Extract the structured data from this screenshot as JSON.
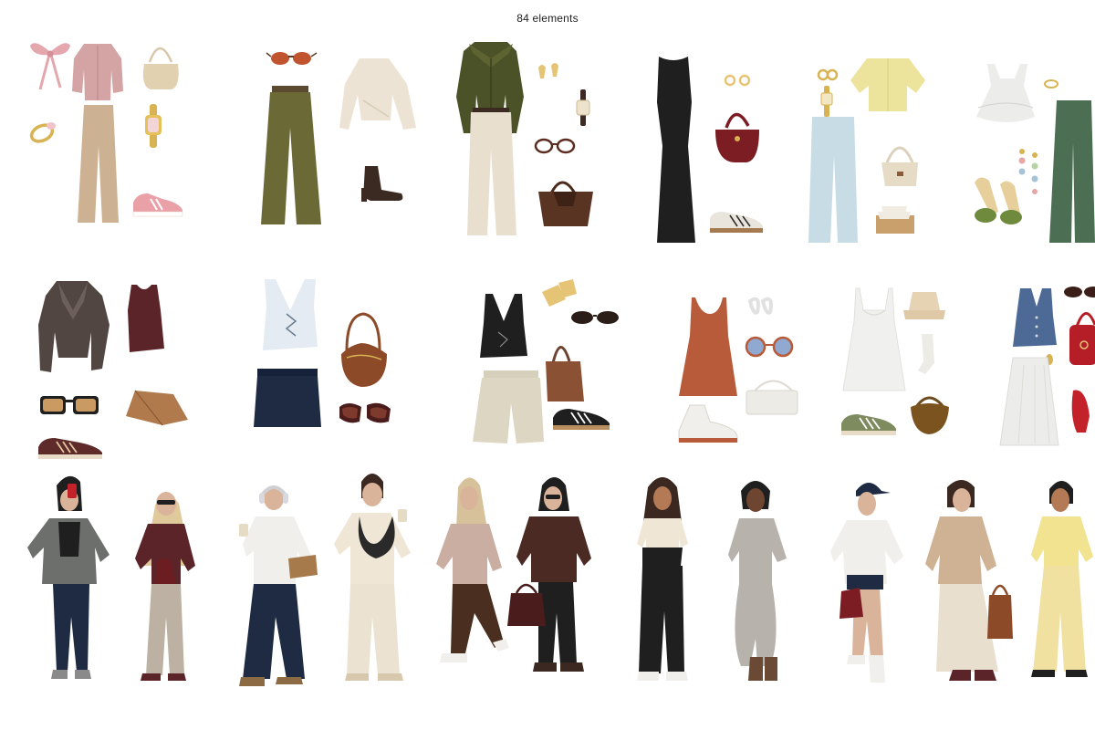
{
  "header": {
    "label": "84 elements"
  },
  "palette": {
    "background": "#ffffff",
    "pink": "#d9a5a8",
    "beige": "#cdb397",
    "olive": "#6c6a33",
    "forest": "#556237",
    "cream": "#e8dfcf",
    "black": "#1f1f1f",
    "burgundy": "#7b1d22",
    "light_blue": "#c8dce6",
    "butter_yellow": "#ece49c",
    "green": "#4c6e53",
    "brown_leather": "#5a4a44",
    "maroon": "#5a2428",
    "navy": "#1f2b43",
    "rust": "#b85b3a",
    "cognac": "#8c4a28",
    "denim_vest": "#4d6a96",
    "red": "#c4222b",
    "skin_light": "#d9b39a",
    "skin_medium": "#b47a56",
    "skin_dark": "#6e4530"
  },
  "outfit_sets": [
    {
      "name": "pink-bow-set",
      "icons": [
        "bow-icon",
        "cardigan-icon",
        "shoulder-bag-icon",
        "ring-icon",
        "trousers-icon",
        "watch-icon",
        "sneaker-icon"
      ]
    },
    {
      "name": "olive-wide-leg-set",
      "icons": [
        "sunglasses-icon",
        "trousers-icon",
        "sweater-icon",
        "ankle-boot-icon"
      ]
    },
    {
      "name": "olive-zip-top-set",
      "icons": [
        "zip-top-icon",
        "earrings-icon",
        "watch-icon",
        "trousers-icon",
        "glasses-icon",
        "tote-bag-icon"
      ]
    },
    {
      "name": "black-maxi-dress-set",
      "icons": [
        "maxi-dress-icon",
        "earrings-icon",
        "handbag-icon",
        "sneaker-icon"
      ]
    },
    {
      "name": "yellow-blouse-set",
      "icons": [
        "earrings-icon",
        "blouse-icon",
        "watch-icon",
        "jeans-icon",
        "handbag-icon",
        "sandal-icon"
      ]
    },
    {
      "name": "green-trouser-set",
      "icons": [
        "ruffle-top-icon",
        "ring-icon",
        "trousers-icon",
        "heels-icon",
        "earrings-icon"
      ]
    },
    {
      "name": "leather-jacket-set",
      "icons": [
        "jacket-icon",
        "tank-top-icon",
        "sunglasses-icon",
        "clutch-icon",
        "sneaker-icon"
      ]
    },
    {
      "name": "white-vest-set",
      "icons": [
        "vest-icon",
        "shoulder-bag-icon",
        "skirt-icon",
        "sunglasses-icon"
      ]
    },
    {
      "name": "black-vest-shorts-set",
      "icons": [
        "vest-icon",
        "earrings-icon",
        "sunglasses-icon",
        "bag-icon",
        "shorts-icon",
        "sneaker-icon"
      ]
    },
    {
      "name": "rust-dress-set",
      "icons": [
        "dress-icon",
        "earrings-icon",
        "sunglasses-icon",
        "sneaker-icon",
        "crossbody-bag-icon"
      ]
    },
    {
      "name": "white-slip-dress-set",
      "icons": [
        "slip-dress-icon",
        "bucket-hat-icon",
        "socks-icon",
        "sneaker-icon",
        "hobo-bag-icon"
      ]
    },
    {
      "name": "denim-vest-set",
      "icons": [
        "vest-icon",
        "sunglasses-icon",
        "handbag-icon",
        "earrings-icon",
        "skirt-icon",
        "flats-icon"
      ]
    }
  ],
  "figures": [
    {
      "name": "figure-selfie-grey-blazer"
    },
    {
      "name": "figure-burgundy-top"
    },
    {
      "name": "figure-headphones-coffee"
    },
    {
      "name": "figure-cream-coat-coffee"
    },
    {
      "name": "figure-beige-sweater-walking"
    },
    {
      "name": "figure-brown-leather-jacket"
    },
    {
      "name": "figure-cream-vest"
    },
    {
      "name": "figure-knit-dress"
    },
    {
      "name": "figure-white-shirt-cap"
    },
    {
      "name": "figure-beige-sweater-skirt"
    },
    {
      "name": "figure-yellow-blouse"
    }
  ]
}
